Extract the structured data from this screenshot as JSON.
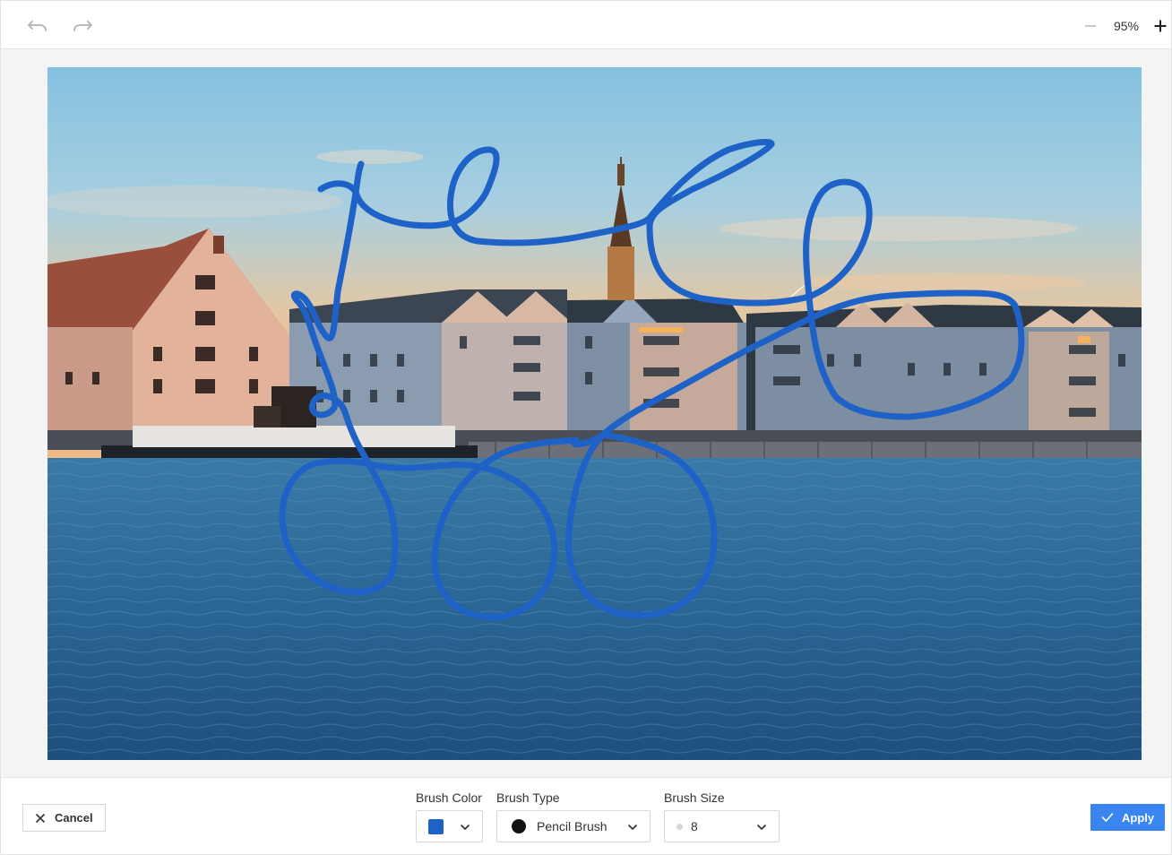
{
  "toolbar": {
    "undo_icon": "undo-icon",
    "redo_icon": "redo-icon",
    "zoom_out_icon": "minus-icon",
    "zoom_level": "95%",
    "zoom_in_icon": "plus-icon"
  },
  "canvas": {
    "image_alt": "Waterfront buildings at sunset with blue brush strokes",
    "stroke_color": "#1e62c8"
  },
  "footer": {
    "cancel_label": "Cancel",
    "brush_color": {
      "label": "Brush Color",
      "value": "#1e62c8"
    },
    "brush_type": {
      "label": "Brush Type",
      "value": "Pencil Brush"
    },
    "brush_size": {
      "label": "Brush Size",
      "value": "8"
    },
    "apply_label": "Apply"
  },
  "colors": {
    "accent": "#3a86f0",
    "brush": "#1e62c8"
  }
}
